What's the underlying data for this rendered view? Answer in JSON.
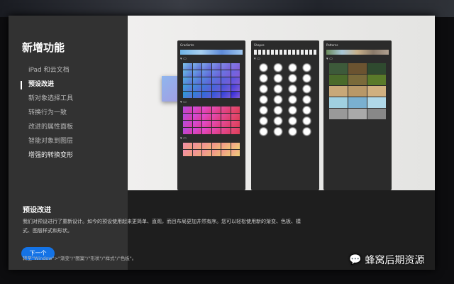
{
  "sidebar": {
    "title": "新增功能",
    "items": [
      "iPad 和云文档",
      "预设改进",
      "新对象选择工具",
      "转换行为一致",
      "改进的属性面板",
      "智能对象到图层",
      "增强的转换变形"
    ],
    "active_index": 1,
    "next_button": "下一个"
  },
  "panels": [
    "Gradients",
    "Shapes",
    "Patterns"
  ],
  "content": {
    "heading": "预设改进",
    "description": "我们对预设进行了重新设计。如今的预设使用起来更简单、直观，而且布局更加井然有序。您可以轻松使用新的渐变、色板、模式、图层样式和形状。",
    "path": "转至\"Window\">\"渐变\"/\"图案\"/\"形状\"/\"样式\"/\"色板\"。"
  },
  "watermark": "蜂窝后期资源",
  "colors": {
    "accent": "#1473e6"
  }
}
